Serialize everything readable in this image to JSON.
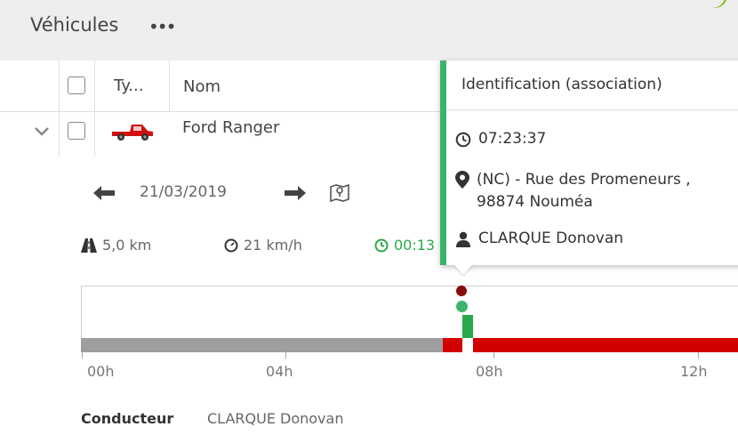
{
  "header": {
    "title": "Véhicules",
    "more_label": "•••"
  },
  "columns": {
    "type_label": "Ty...",
    "name_label": "Nom"
  },
  "row": {
    "name": "Ford Ranger",
    "vehicle_icon": "pickup-truck-icon",
    "vehicle_color": "#d01010"
  },
  "trip": {
    "date": "21/03/2019",
    "distance": "5,0 km",
    "speed": "21 km/h",
    "duration_partial": "00:13"
  },
  "timeline": {
    "ticks": [
      "00h",
      "04h",
      "08h",
      "12h"
    ],
    "colors": {
      "idle": "#9e9e9e",
      "alert": "#d30000",
      "active": "#2aa84a",
      "event_start": "#8b0b0b",
      "event_point": "#3cb56a"
    }
  },
  "driver": {
    "label": "Conducteur",
    "name": "CLARQUE Donovan"
  },
  "popup": {
    "title": "Identification (association)",
    "time": "07:23:37",
    "address_line1": "(NC) - Rue des Promeneurs ,",
    "address_line2": "98874 Nouméa",
    "driver": "CLARQUE Donovan"
  }
}
